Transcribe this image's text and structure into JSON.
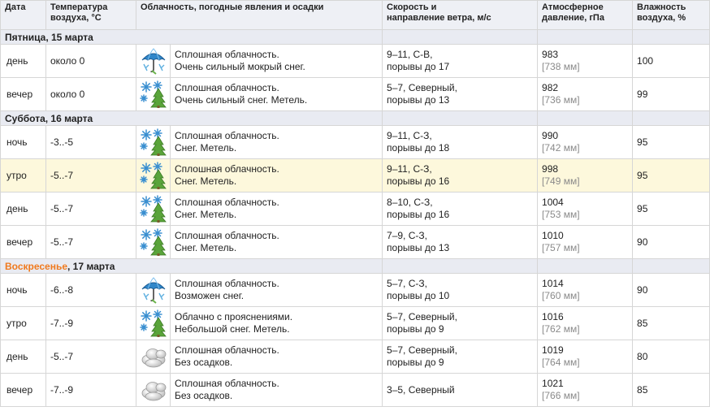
{
  "header": {
    "date": "Дата",
    "temp_line1": "Температура",
    "temp_line2": "воздуха, °C",
    "clouds": "Облачность, погодные явления и осадки",
    "wind_line1": "Скорость и",
    "wind_line2": "направление ветра, м/с",
    "press_line1": "Атмосферное",
    "press_line2": "давление, гПа",
    "hum_line1": "Влажность",
    "hum_line2": "воздуха, %"
  },
  "days": [
    {
      "weekday": "Пятница",
      "date": ", 15 марта",
      "rows": [
        {
          "time": "день",
          "temp": "около 0",
          "icon": "umbrella-snow-icon",
          "desc1": "Сплошная облачность.",
          "desc2": "Очень сильный мокрый снег.",
          "wind1": "9–11, С-В,",
          "wind2": "порывы до 17",
          "press": "983",
          "press_mm": "[738 мм]",
          "hum": "100"
        },
        {
          "time": "вечер",
          "temp": "около 0",
          "icon": "snowflake-tree-icon",
          "desc1": "Сплошная облачность.",
          "desc2": "Очень сильный снег. Метель.",
          "wind1": "5–7, Северный,",
          "wind2": "порывы до 13",
          "press": "982",
          "press_mm": "[736 мм]",
          "hum": "99"
        }
      ]
    },
    {
      "weekday": "Суббота",
      "date": ", 16 марта",
      "rows": [
        {
          "time": "ночь",
          "temp": "-3..-5",
          "icon": "snowflake-tree-icon",
          "desc1": "Сплошная облачность.",
          "desc2": "Снег. Метель.",
          "wind1": "9–11, С-З,",
          "wind2": "порывы до 18",
          "press": "990",
          "press_mm": "[742 мм]",
          "hum": "95"
        },
        {
          "time": "утро",
          "temp": "-5..-7",
          "icon": "snowflake-tree-icon",
          "desc1": "Сплошная облачность.",
          "desc2": "Снег. Метель.",
          "wind1": "9–11, С-З,",
          "wind2": "порывы до 16",
          "press": "998",
          "press_mm": "[749 мм]",
          "hum": "95",
          "highlight": true
        },
        {
          "time": "день",
          "temp": "-5..-7",
          "icon": "snowflake-tree-icon",
          "desc1": "Сплошная облачность.",
          "desc2": "Снег. Метель.",
          "wind1": "8–10, С-З,",
          "wind2": "порывы до 16",
          "press": "1004",
          "press_mm": "[753 мм]",
          "hum": "95"
        },
        {
          "time": "вечер",
          "temp": "-5..-7",
          "icon": "snowflake-tree-icon",
          "desc1": "Сплошная облачность.",
          "desc2": "Снег. Метель.",
          "wind1": "7–9, С-З,",
          "wind2": "порывы до 13",
          "press": "1010",
          "press_mm": "[757 мм]",
          "hum": "90"
        }
      ]
    },
    {
      "weekday": "Воскресенье",
      "date": ", 17 марта",
      "weekend": true,
      "rows": [
        {
          "time": "ночь",
          "temp": "-6..-8",
          "icon": "umbrella-snow-icon",
          "desc1": "Сплошная облачность.",
          "desc2": "Возможен снег.",
          "wind1": "5–7, С-З,",
          "wind2": "порывы до 10",
          "press": "1014",
          "press_mm": "[760 мм]",
          "hum": "90"
        },
        {
          "time": "утро",
          "temp": "-7..-9",
          "icon": "snowflake-tree-icon",
          "desc1": "Облачно с прояснениями.",
          "desc2": "Небольшой снег. Метель.",
          "wind1": "5–7, Северный,",
          "wind2": "порывы до 9",
          "press": "1016",
          "press_mm": "[762 мм]",
          "hum": "85"
        },
        {
          "time": "день",
          "temp": "-5..-7",
          "icon": "cloud-icon",
          "desc1": "Сплошная облачность.",
          "desc2": "Без осадков.",
          "wind1": "5–7, Северный,",
          "wind2": "порывы до 9",
          "press": "1019",
          "press_mm": "[764 мм]",
          "hum": "80"
        },
        {
          "time": "вечер",
          "temp": "-7..-9",
          "icon": "cloud-icon",
          "desc1": "Сплошная облачность.",
          "desc2": "Без осадков.",
          "wind1": "3–5, Северный",
          "wind2": "",
          "press": "1021",
          "press_mm": "[766 мм]",
          "hum": "85"
        }
      ]
    }
  ],
  "colors": {
    "header_bg": "#eef0f5",
    "day_bg": "#e9ebf2",
    "highlight_bg": "#fdf8dc",
    "weekend": "#f07a1e",
    "border": "#d6d6d6",
    "muted": "#8a8a8a"
  }
}
